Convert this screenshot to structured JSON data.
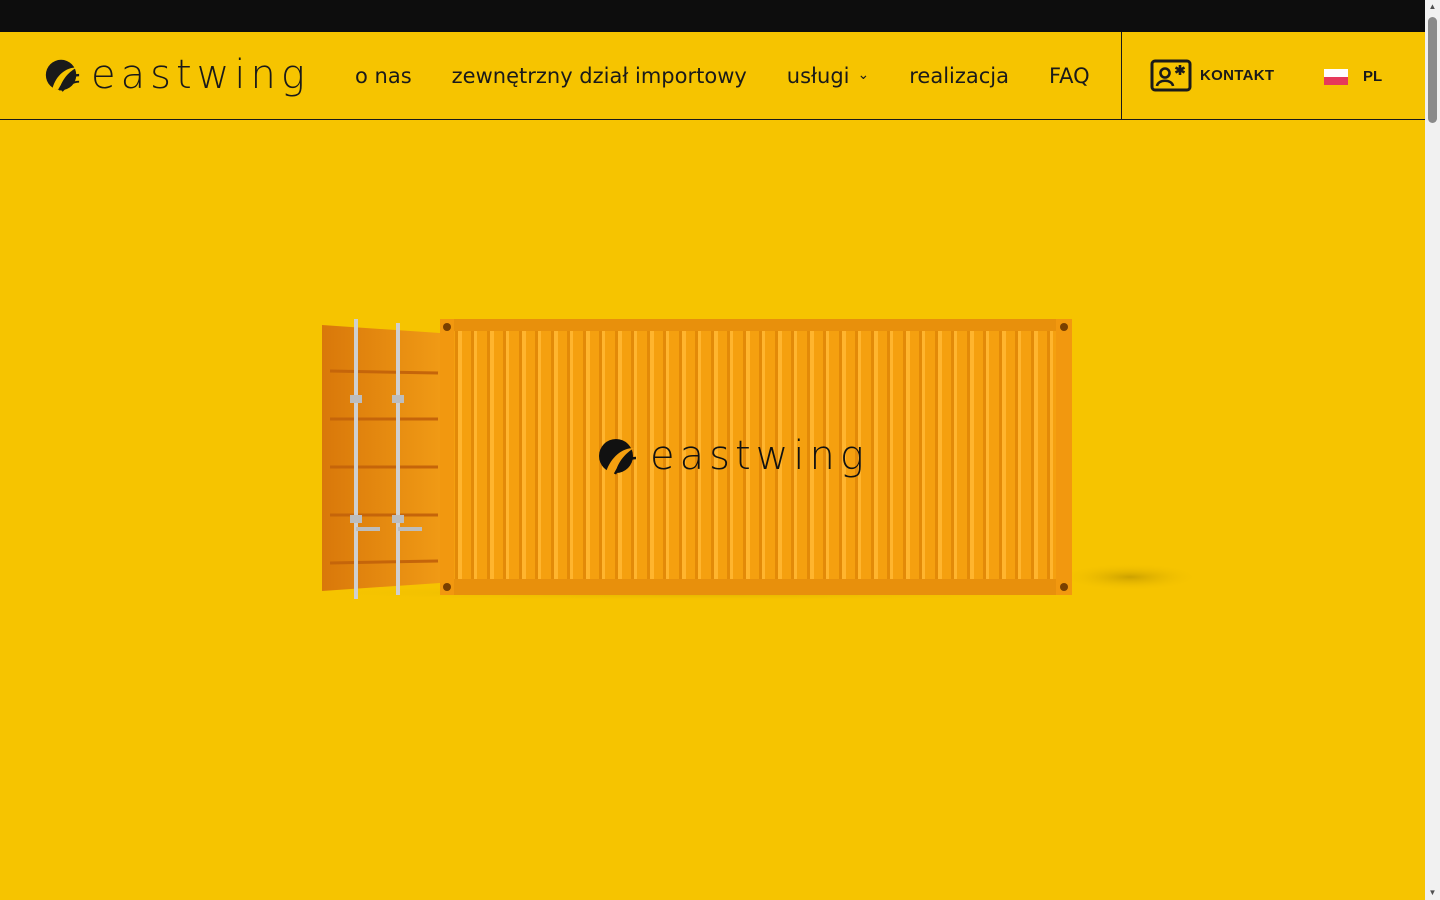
{
  "colors": {
    "brand_yellow": "#f6c400",
    "container_orange": "#f5a00f",
    "text_dark": "#1a1a1a",
    "top_bar": "#0d0d0d"
  },
  "header": {
    "logo_text": "eastwing",
    "nav": [
      {
        "label": "o nas"
      },
      {
        "label": "zewnętrzny dział importowy"
      },
      {
        "label": "usługi",
        "has_dropdown": true
      },
      {
        "label": "realizacja"
      },
      {
        "label": "FAQ"
      }
    ],
    "contact": {
      "label": "KONTAKT",
      "icon": "contact-card-icon"
    },
    "language": {
      "label": "PL",
      "icon": "poland-flag-icon"
    }
  },
  "hero": {
    "image": "orange-shipping-container",
    "container_logo_text": "eastwing"
  }
}
